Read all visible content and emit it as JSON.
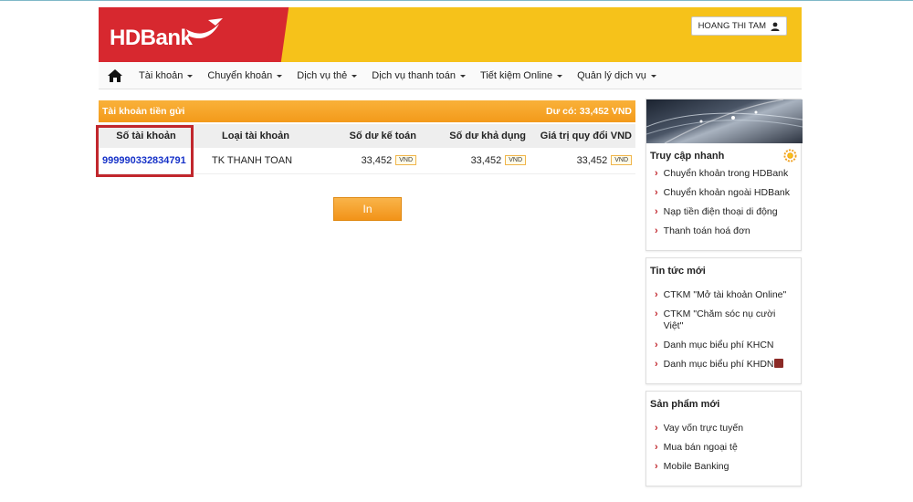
{
  "header": {
    "logo_text": "HDBank",
    "user_name": "HOANG THI TAM",
    "colors": {
      "brand_red": "#d7282f",
      "brand_yellow": "#f6c21a",
      "accent_orange": "#f39a1a"
    }
  },
  "nav": {
    "items": [
      {
        "label": "Tài khoản"
      },
      {
        "label": "Chuyển khoản"
      },
      {
        "label": "Dịch vụ thẻ"
      },
      {
        "label": "Dịch vụ thanh toán"
      },
      {
        "label": "Tiết kiệm Online"
      },
      {
        "label": "Quản lý dịch vụ"
      }
    ]
  },
  "accounts": {
    "title": "Tài khoản tiền gửi",
    "balance_text": "Dư có: 33,452 VND",
    "columns": [
      "Số tài khoản",
      "Loại tài khoản",
      "Số dư kế toán",
      "Số dư khả dụng",
      "Giá trị quy đổi VND"
    ],
    "rows": [
      {
        "account_no": "999990332834791",
        "type": "TK THANH TOAN",
        "ledger": "33,452",
        "available": "33,452",
        "converted": "33,452",
        "currency": "VND"
      }
    ]
  },
  "print_label": "In",
  "sidebar": {
    "quick_access": {
      "title": "Truy cập nhanh",
      "links": [
        "Chuyển khoản trong HDBank",
        "Chuyển khoản ngoài HDBank",
        "Nạp tiền điện thoại di động",
        "Thanh toán hoá đơn"
      ]
    },
    "news": {
      "title": "Tin tức mới",
      "links": [
        "CTKM \"Mở tài khoản Online\"",
        "CTKM \"Chăm sóc nụ cười Việt\"",
        "Danh mục biểu phí KHCN",
        "Danh mục biểu phí KHDN"
      ]
    },
    "products": {
      "title": "Sản phẩm mới",
      "links": [
        "Vay vốn trực tuyến",
        "Mua bán ngoại tệ",
        "Mobile Banking"
      ]
    }
  }
}
